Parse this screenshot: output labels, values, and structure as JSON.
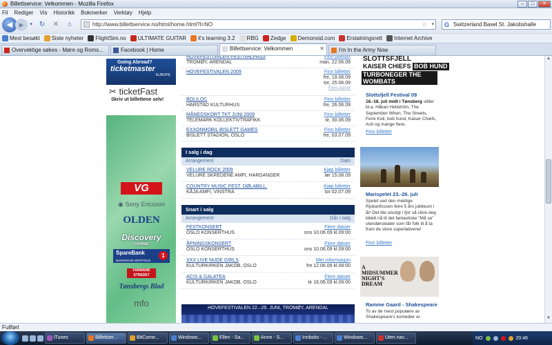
{
  "window": {
    "title": "Billettservice: Velkommen - Mozilla Firefox"
  },
  "menu": [
    "Fil",
    "Rediger",
    "Vis",
    "Historikk",
    "Bokmerker",
    "Verktøy",
    "Hjelp"
  ],
  "nav": {
    "url": "http://www.billettservice.no/html/home.html?l=NO",
    "search_text": "Switzerland   Basel   St. Jakobshalle"
  },
  "bookmarks": [
    {
      "label": "Mest besøkt",
      "color": "#4a7fd0"
    },
    {
      "label": "Siste nyheter",
      "color": "#e0a030"
    },
    {
      "label": "FlightSim.no",
      "color": "#333333"
    },
    {
      "label": "ULTIMATE GUITAR",
      "color": "#c8281e"
    },
    {
      "label": "it's learning 3.2",
      "color": "#e87722"
    },
    {
      "label": "RBG",
      "color": "#e0e0e0"
    },
    {
      "label": "Zedge",
      "color": "#cc2222"
    },
    {
      "label": "Demonoid.com",
      "color": "#d4b000"
    },
    {
      "label": "Erstatningsrett",
      "color": "#cc3333"
    },
    {
      "label": "Internet Archive",
      "color": "#555555"
    }
  ],
  "tabs": [
    {
      "label": "Overvektige søkes - Møre og Roms...",
      "color": "#c8281e",
      "active": false
    },
    {
      "label": "Facebook | Home",
      "color": "#3b5998",
      "active": false
    },
    {
      "label": "Billettservice: Velkommen",
      "color": "#d8dde6",
      "active": true
    },
    {
      "label": "I'm In the Army Now",
      "color": "#e87722",
      "active": false
    }
  ],
  "left": {
    "abroad": "Going Abroad?",
    "ticketmaster": "ticketmaster",
    "europe": "EUROPE",
    "ticketfast": "ticketFast",
    "skriv_ut": "Skriv ut billettene selv!",
    "sponsors": {
      "vg": "VG",
      "sonyericsson": "Sony Ericsson",
      "olden": "OLDEN",
      "discovery": "Discovery",
      "channel": "CHANNEL",
      "sparebank": "SpareBank",
      "sparebank_sub": "BUSKERUD-VESTFOLD",
      "sparebank_num": "1",
      "farmand": "FARMAND STREDET",
      "tonsberg": "Tønsbergs Blad",
      "mfo": "mfo"
    }
  },
  "top_events": [
    {
      "name": "HOVEFESTIVALEN FESTIVALPASS",
      "place": "TROMØY, ARENDAL",
      "link": "Finn billetter",
      "dates": [
        "man, 22.06.09"
      ],
      "more": ""
    },
    {
      "name": "HOVEFESTIVALEN 2009",
      "place": "",
      "link": "Finn billetter",
      "dates": [
        "fre, 19.06.09",
        "tor, 25.06.09"
      ],
      "more": "Flere datoer"
    },
    {
      "name": "BOLILOC",
      "place": "HARSTAD KULTURHUS",
      "link": "Finn billetter",
      "dates": [
        "fre, 26.06.09"
      ],
      "more": ""
    },
    {
      "name": "MÅNEDSKORT TKT JUNI 2009",
      "place": "TELEMARK KOLLEKTIVTRAFIKK",
      "link": "Finn billetter",
      "dates": [
        "tir, 30.06.09"
      ],
      "more": ""
    },
    {
      "name": "EXXONMOBIL BISLETT GAMES",
      "place": "BISLETT STADION, OSLO",
      "link": "Finn billetter",
      "dates": [
        "fre, 03.07.09"
      ],
      "more": ""
    }
  ],
  "i_salg": {
    "heading": "I salg i dag",
    "col_left": "Arrangement",
    "col_right": "Dato",
    "events": [
      {
        "name": "VELURE ROCK 2009",
        "place": "VELURE SKREDENE AMFI, HARDANGER",
        "link": "Kjøp billetter",
        "date": "lør 15.08.09"
      },
      {
        "name": "COUNTRY MUSIC FEST. DØLABILL.",
        "place": "KÅJA AMFI, VINSTRA",
        "link": "Kjøp billetter",
        "date": "tor 02.07.09"
      }
    ]
  },
  "snart": {
    "heading": "Snart i salg",
    "col_left": "Arrangement",
    "col_right": "Går i salg",
    "events": [
      {
        "name": "FESTKONSERT",
        "place": "OSLO KONSERTHUS",
        "link": "Flere datoer",
        "date": "ons 10.06.09 kl.09:00"
      },
      {
        "name": "ÅPNINGSKONSERT",
        "place": "OSLO KONSERTHUS",
        "link": "Flere datoer",
        "date": "ons 10.06.09 kl.09:00"
      },
      {
        "name": "XXX LIVE NUDE GIRLS",
        "place": "KULTURKIRKEN JAKOB, OSLO",
        "link": "Mer informasjon",
        "date": "fre 12.06.09 kl.08:00"
      },
      {
        "name": "ACIS & GALATEA",
        "place": "KULTURKIRKEN JAKOB, OSLO",
        "link": "Flere datoer",
        "date": "tir 16.06.09 kl.09:00"
      }
    ]
  },
  "bottom_banner": "HOVEFESTIVALEN 22.–25. JUNI, TROMØY, ARENDAL",
  "right": {
    "slott_img": {
      "line1": "SLOTTSFJELL",
      "kaiser": "KAISER CHIEFS",
      "bobhund": "BOB HUND",
      "line3": "TURBONEGER THE WOMBATS"
    },
    "slott_title": "Slottsfjell Festival 09",
    "slott_text_bold": "16.-18. juli midt i Tønsberg",
    "slott_text": "stiller bl.a. Håkan Hellström, The September When, The Streets, Femi Kuti, bob hund, Kaiser Chiefs, Ash og mange flere.",
    "slott_link": "Finn billetter",
    "mari_title": "Marispelet 23.-26. juli",
    "mari_text": "Spelet ved den mektige Rjukanfossen feire 5 års jubileum i år! Det ble utsolgt i fjor så sikre deg billett nå til det fantastiske \"Må se\" utendørsteater som får folk til å ta fram de store superlativene!",
    "mari_link": "Finn billetter",
    "msnd_img_text": "A MIDSUMMER NIGHT'S DREAM",
    "msnd_title": "Ramme Gaard - Shakespeare",
    "msnd_text": "To av de mest populære av Shakespeare's komedier er"
  },
  "status": "Fullført",
  "taskbar": {
    "items": [
      {
        "label": "iTunes",
        "color": "#9b59b6"
      },
      {
        "label": "Billettser...",
        "color": "#e87722",
        "active": true
      },
      {
        "label": "BitCome...",
        "color": "#e0a030"
      },
      {
        "label": "Windows...",
        "color": "#4a7fd0"
      },
      {
        "label": "Ellen - Sa...",
        "color": "#7ac143"
      },
      {
        "label": "Anne - S...",
        "color": "#7ac143"
      },
      {
        "label": "Innboks - ...",
        "color": "#4a7fd0"
      },
      {
        "label": "Windows...",
        "color": "#4a7fd0"
      },
      {
        "label": "Uten nav...",
        "color": "#cc3333"
      }
    ],
    "lang": "NO",
    "time": "20:46"
  }
}
